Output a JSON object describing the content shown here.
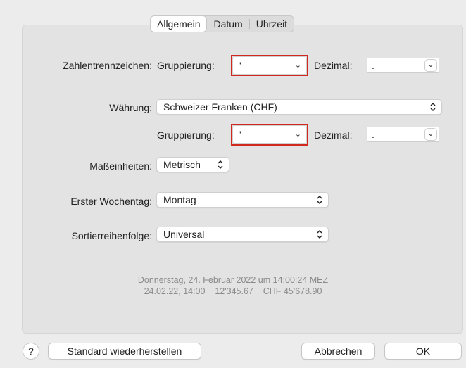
{
  "tabs": [
    {
      "label": "Allgemein",
      "selected": true
    },
    {
      "label": "Datum",
      "selected": false
    },
    {
      "label": "Uhrzeit",
      "selected": false
    }
  ],
  "number_separators": {
    "label": "Zahlentrennzeichen:",
    "grouping_label": "Gruppierung:",
    "grouping_value": "'",
    "decimal_label": "Dezimal:",
    "decimal_value": "."
  },
  "currency": {
    "label": "Währung:",
    "value": "Schweizer Franken (CHF)",
    "grouping_label": "Gruppierung:",
    "grouping_value": "'",
    "decimal_label": "Dezimal:",
    "decimal_value": "."
  },
  "units": {
    "label": "Maßeinheiten:",
    "value": "Metrisch"
  },
  "first_weekday": {
    "label": "Erster Wochentag:",
    "value": "Montag"
  },
  "sort_order": {
    "label": "Sortierreihenfolge:",
    "value": "Universal"
  },
  "preview": {
    "line1": "Donnerstag, 24. Februar 2022 um 14:00:24 MEZ",
    "line2": "24.02.22, 14:00    12'345.67    CHF 45'678.90"
  },
  "buttons": {
    "help": "?",
    "restore": "Standard wiederherstellen",
    "cancel": "Abbrechen",
    "ok": "OK"
  },
  "colors": {
    "highlight": "#d0291f"
  }
}
